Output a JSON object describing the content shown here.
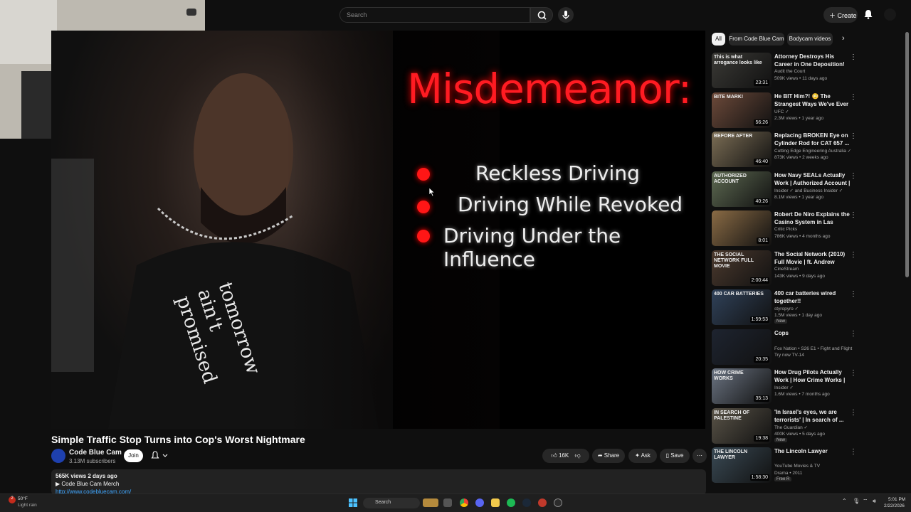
{
  "header": {
    "search_placeholder": "Search",
    "create_label": "Create"
  },
  "video": {
    "overlay_title": "Misdemeanor:",
    "charges": [
      "Reckless Driving",
      "Driving While Revoked",
      "Driving Under the Influence"
    ],
    "shirt_text": "tomorrow ain't promised",
    "title": "Simple Traffic Stop Turns into Cop's Worst Nightmare",
    "channel": "Code Blue Cam",
    "subscribers": "3.13M subscribers",
    "join_label": "Join",
    "likes": "16K",
    "share_label": "Share",
    "ask_label": "Ask",
    "save_label": "Save",
    "stats": "565K views  2 days ago",
    "merch": "▶ Code Blue Cam Merch",
    "link": "http://www.codebluecam.com/"
  },
  "sidebar": {
    "chips": [
      "All",
      "From Code Blue Cam",
      "Bodycam videos"
    ],
    "recommendations": [
      {
        "title": "Attorney Destroys His Career in One Deposition!",
        "channel": "Audit the Court",
        "stats": "509K views • 11 days ago",
        "duration": "23:31",
        "overlay": "This is what arrogance looks like",
        "color": "#3b3a36"
      },
      {
        "title": "He BIT Him?! 😳 The Strangest Ways We've Ever Seen A Fight ...",
        "channel": "UFC ✓",
        "stats": "2.3M views • 1 year ago",
        "duration": "56:26",
        "overlay": "BITE MARK!",
        "color": "#6d4a3a"
      },
      {
        "title": "Replacing BROKEN Eye on Cylinder Rod for CAT 657 ...",
        "channel": "Cutting Edge Engineering Australia ✓",
        "stats": "873K views • 2 weeks ago",
        "duration": "46:40",
        "overlay": "BEFORE   AFTER",
        "color": "#7c6e55"
      },
      {
        "title": "How Navy SEALs Actually Work | Authorized Account | Insider",
        "channel": "Insider ✓ and Business Insider ✓",
        "stats": "8.1M views • 1 year ago",
        "duration": "40:26",
        "overlay": "AUTHORIZED ACCOUNT",
        "color": "#5e6a52"
      },
      {
        "title": "Robert De Niro Explains the Casino System in Las Vegas | ...",
        "channel": "Critic Picks",
        "stats": "786K views • 4 months ago",
        "duration": "8:01",
        "overlay": "",
        "color": "#8a6b45"
      },
      {
        "title": "The Social Network (2010) Full Movie | ft. Andrew Garfield an...",
        "channel": "CineStream",
        "stats": "143K views • 9 days ago",
        "duration": "2:00:44",
        "overlay": "THE SOCIAL NETWORK FULL MOVIE",
        "color": "#4c3a2e"
      },
      {
        "title": "400 car batteries wired together!!",
        "channel": "styropyro ✓",
        "stats": "1.5M views • 1 day ago",
        "duration": "1:59:53",
        "overlay": "400 CAR BATTERIES",
        "badge": "New",
        "color": "#30425a"
      },
      {
        "title": "Cops",
        "channel": "Fox Nation • S26 E1 • Fight and Flight ✓",
        "stats": "Try now  TV-14",
        "duration": "20:35",
        "overlay": "",
        "color": "#1e2430"
      },
      {
        "title": "How Drug Pilots Actually Work | How Crime Works | Insider",
        "channel": "Insider ✓",
        "stats": "1.6M views • 7 months ago",
        "duration": "35:13",
        "overlay": "HOW CRIME WORKS",
        "color": "#6b7482"
      },
      {
        "title": "'In Israel's eyes, we are terrorists' | In search of ...",
        "channel": "The Guardian ✓",
        "stats": "400K views • 5 days ago",
        "duration": "19:38",
        "overlay": "IN SEARCH OF PALESTINE",
        "badge": "New",
        "color": "#5a5448"
      },
      {
        "title": "The Lincoln Lawyer",
        "channel": "YouTube Movies & TV",
        "stats": "Drama • 2011",
        "duration": "1:58:30",
        "overlay": "THE LINCOLN LAWYER",
        "badge": "Free  R",
        "color": "#3a4a55"
      }
    ]
  },
  "taskbar": {
    "weather_temp": "50°F",
    "weather_desc": "Light rain",
    "weather_badge": "2",
    "search_label": "Search",
    "time": "5:01 PM",
    "date": "2/22/2026"
  }
}
